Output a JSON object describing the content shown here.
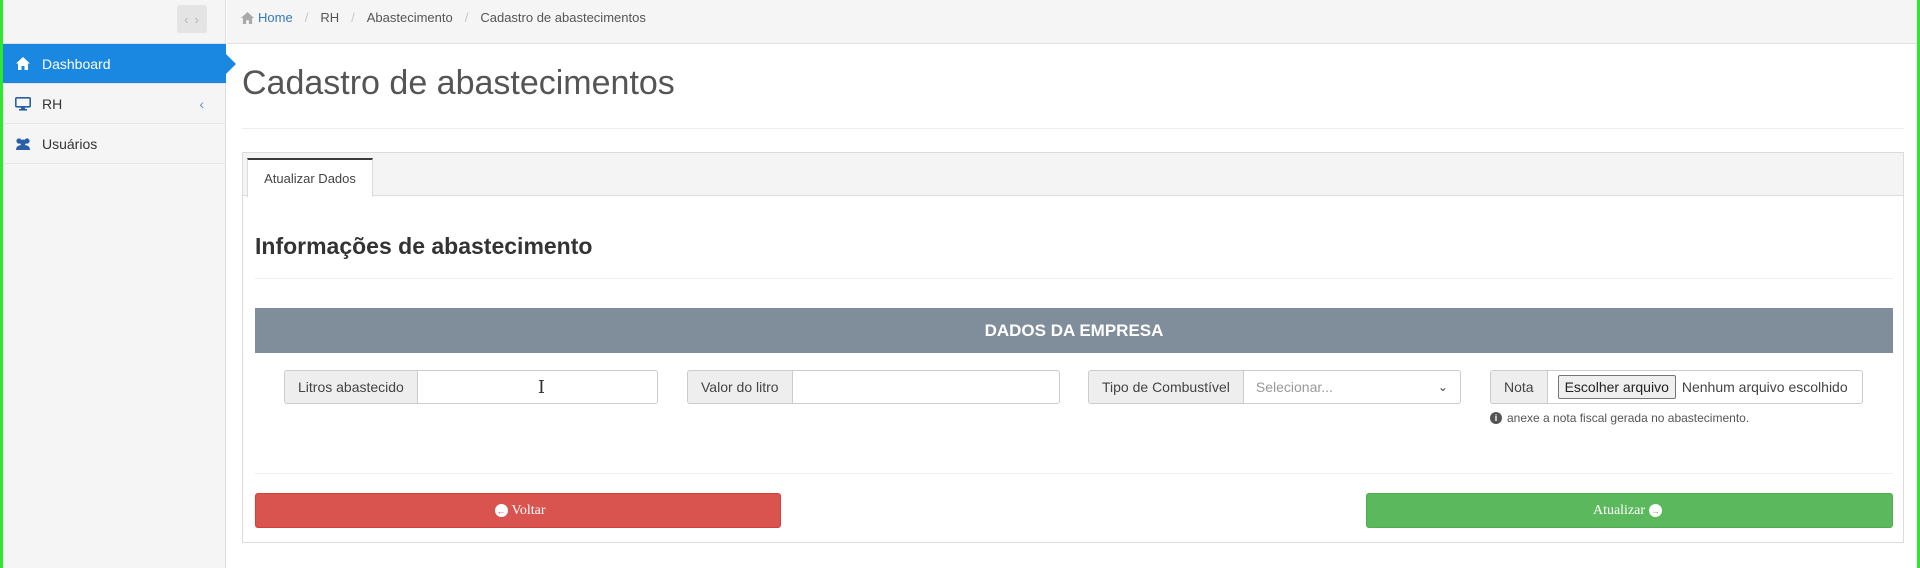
{
  "sidebar": {
    "toggle_icon": "chevrons-left-right-icon",
    "items": [
      {
        "label": "Dashboard",
        "icon": "home-icon",
        "active": true
      },
      {
        "label": "RH",
        "icon": "monitor-icon",
        "has_submenu": true
      },
      {
        "label": "Usuários",
        "icon": "users-icon"
      }
    ]
  },
  "breadcrumb": {
    "items": [
      "Home",
      "RH",
      "Abastecimento",
      "Cadastro de abastecimentos"
    ]
  },
  "page": {
    "title": "Cadastro de abastecimentos"
  },
  "tabs": [
    {
      "label": "Atualizar Dados",
      "active": true
    }
  ],
  "form": {
    "section_title": "Informações de abastecimento",
    "group_header": "DADOS DA EMPRESA",
    "fields": {
      "litros": {
        "label": "Litros abastecido",
        "value": ""
      },
      "valor": {
        "label": "Valor do litro",
        "value": ""
      },
      "tipo": {
        "label": "Tipo de Combustível",
        "selected": "Selecionar..."
      },
      "nota": {
        "label": "Nota",
        "button_label": "Escolher arquivo",
        "file_status": "Nenhum arquivo escolhido",
        "help": "anexe a nota fiscal gerada no abastecimento."
      }
    },
    "buttons": {
      "back": "Voltar",
      "submit": "Atualizar"
    }
  },
  "colors": {
    "accent": "#1a87e0",
    "section_header": "#808e9b",
    "danger": "#d9534f",
    "success": "#5cb85c",
    "frame": "#2ee82e"
  }
}
